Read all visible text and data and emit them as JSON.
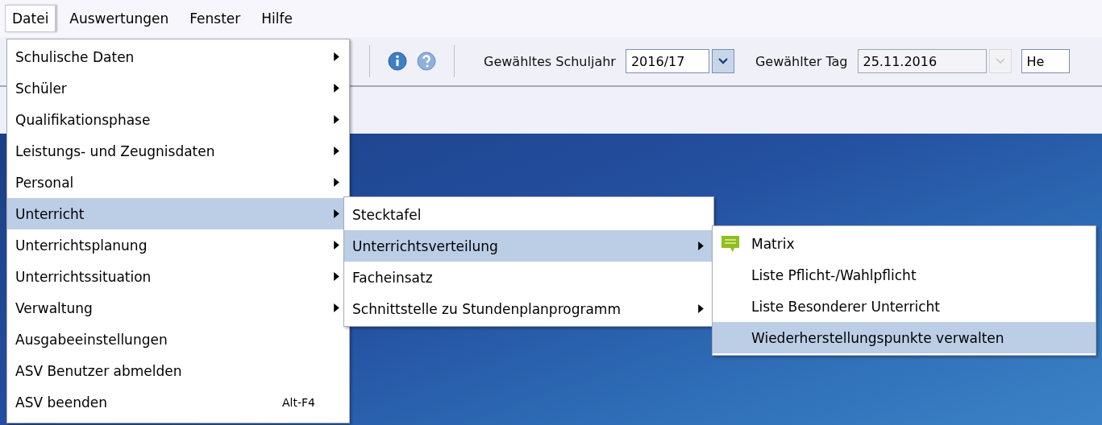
{
  "menubar": [
    {
      "label": "Datei",
      "selected": true
    },
    {
      "label": "Auswertungen",
      "selected": false
    },
    {
      "label": "Fenster",
      "selected": false
    },
    {
      "label": "Hilfe",
      "selected": false
    }
  ],
  "toolbar": {
    "year_label": "Gewähltes Schuljahr",
    "year_value": "2016/17",
    "day_label": "Gewählter Tag",
    "day_value": "25.11.2016",
    "day_dropdown_disabled": true,
    "field_3": "He"
  },
  "menu": [
    {
      "label": "Schulische Daten",
      "kind": "submenu",
      "selected": false
    },
    {
      "label": "Schüler",
      "kind": "submenu",
      "selected": false
    },
    {
      "label": "Qualifikationsphase",
      "kind": "submenu",
      "selected": false
    },
    {
      "label": "Leistungs- und Zeugnisdaten",
      "kind": "submenu",
      "selected": false
    },
    {
      "label": "Personal",
      "kind": "submenu",
      "selected": false
    },
    {
      "label": "Unterricht",
      "kind": "submenu",
      "selected": true
    },
    {
      "label": "Unterrichtsplanung",
      "kind": "submenu",
      "selected": false
    },
    {
      "label": "Unterrichtssituation",
      "kind": "submenu",
      "selected": false
    },
    {
      "label": "Verwaltung",
      "kind": "submenu",
      "selected": false
    },
    {
      "label": "Ausgabeeinstellungen",
      "kind": "command",
      "selected": false
    },
    {
      "label": "ASV Benutzer abmelden",
      "kind": "command",
      "selected": false
    },
    {
      "label": "ASV beenden",
      "kind": "command",
      "selected": false,
      "shortcut": "Alt-F4"
    }
  ],
  "submenu": [
    {
      "label": "Stecktafel",
      "kind": "command",
      "selected": false
    },
    {
      "label": "Unterrichtsverteilung",
      "kind": "submenu",
      "selected": true
    },
    {
      "label": "Facheinsatz",
      "kind": "command",
      "selected": false
    },
    {
      "label": "Schnittstelle zu Stundenplanprogramm",
      "kind": "submenu",
      "selected": false
    }
  ],
  "submenu_2": [
    {
      "label": "Matrix",
      "selected": false,
      "has_icon": true
    },
    {
      "label": "Liste Pflicht-/Wahlpflicht",
      "selected": false,
      "has_icon": false
    },
    {
      "label": "Liste Besonderer Unterricht",
      "selected": false,
      "has_icon": false
    },
    {
      "label": "Wiederherstellungspunkte verwalten",
      "selected": true,
      "has_icon": false
    }
  ]
}
